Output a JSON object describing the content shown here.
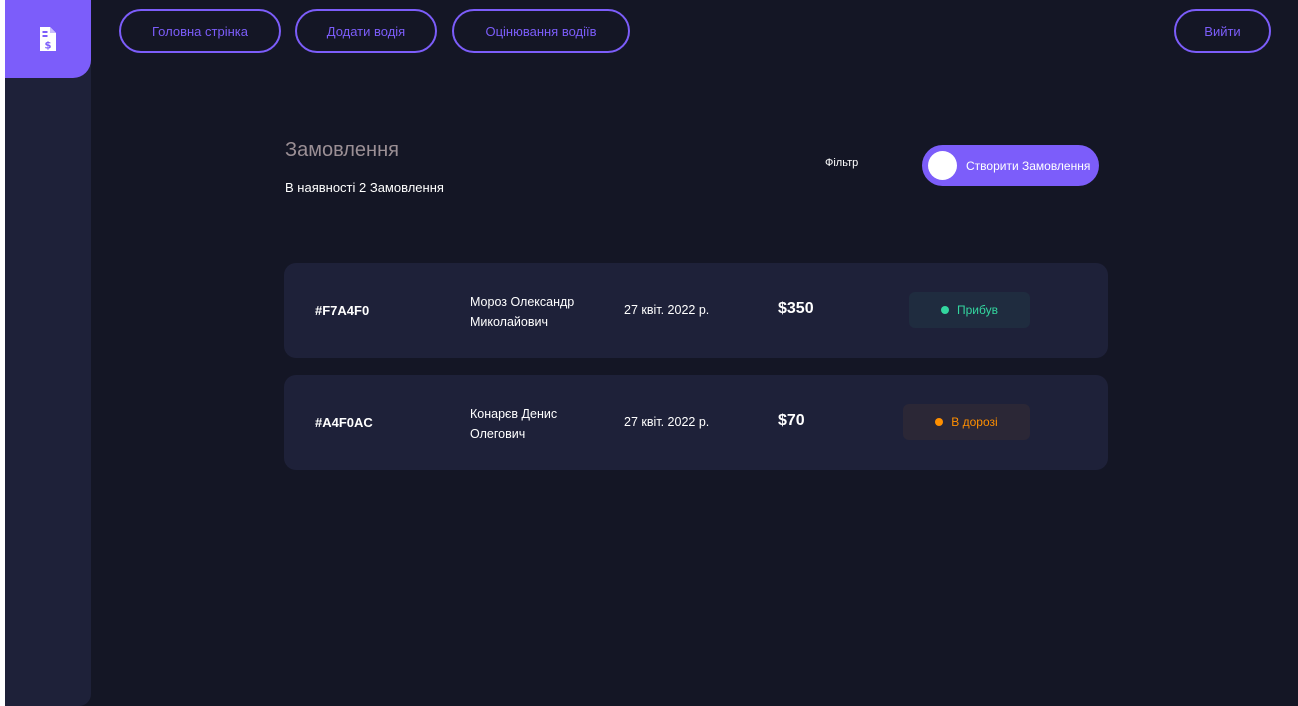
{
  "nav": {
    "home_label": "Головна стрінка",
    "add_driver_label": "Додати водія",
    "rate_drivers_label": "Оцінювання водіїв",
    "logout_label": "Вийти"
  },
  "logo": {
    "icon": "invoice-dollar-icon"
  },
  "header": {
    "title": "Замовлення",
    "subtitle": "В наявності 2 Замовлення",
    "filter_label": "Фільтр",
    "create_label": "Створити Замовлення"
  },
  "orders": [
    {
      "id": "#F7A4F0",
      "name": "Мороз Олександр Миколайович",
      "date": "27 квіт. 2022 р.",
      "amount": "$350",
      "status": "Прибув",
      "status_color": "#33d69f",
      "status_bg": "#1f2c3f"
    },
    {
      "id": "#A4F0AC",
      "name": "Конарєв Денис Олегович",
      "date": "27 квіт. 2022 р.",
      "amount": "$70",
      "status": "В дорозі",
      "status_color": "#ff8f00",
      "status_bg": "#2b2736"
    }
  ],
  "colors": {
    "accent": "#7c5dfa",
    "background": "#141625",
    "card": "#1e2139"
  }
}
